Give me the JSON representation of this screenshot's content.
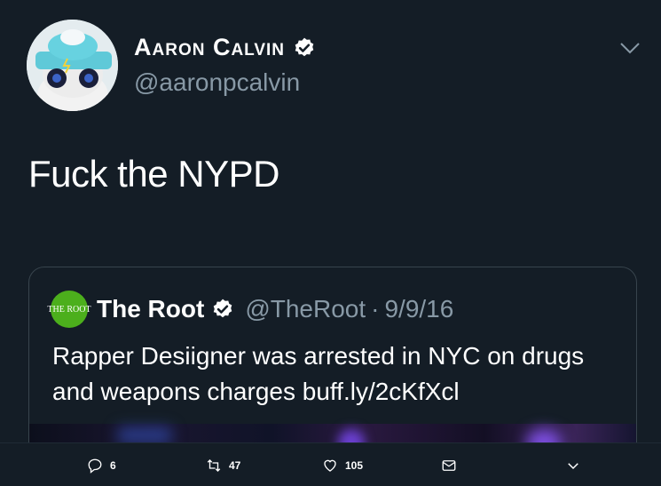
{
  "author": {
    "name": "Aaron Calvin",
    "handle": "@aaronpcalvin"
  },
  "tweet": {
    "text": "Fuck the NYPD"
  },
  "quoted": {
    "logo_text": "THE ROOT",
    "name": "The Root",
    "handle": "@TheRoot",
    "separator": "·",
    "date": "9/9/16",
    "text": "Rapper Desiigner was arrested in NYC on drugs and weapons charges buff.ly/2cKfXcl",
    "logo_color": "#4caf1c"
  },
  "actions": {
    "replies": "6",
    "retweets": "47",
    "likes": "105"
  },
  "colors": {
    "background": "#141d26",
    "secondary_text": "#8899a6",
    "verified": "#ffffff"
  }
}
